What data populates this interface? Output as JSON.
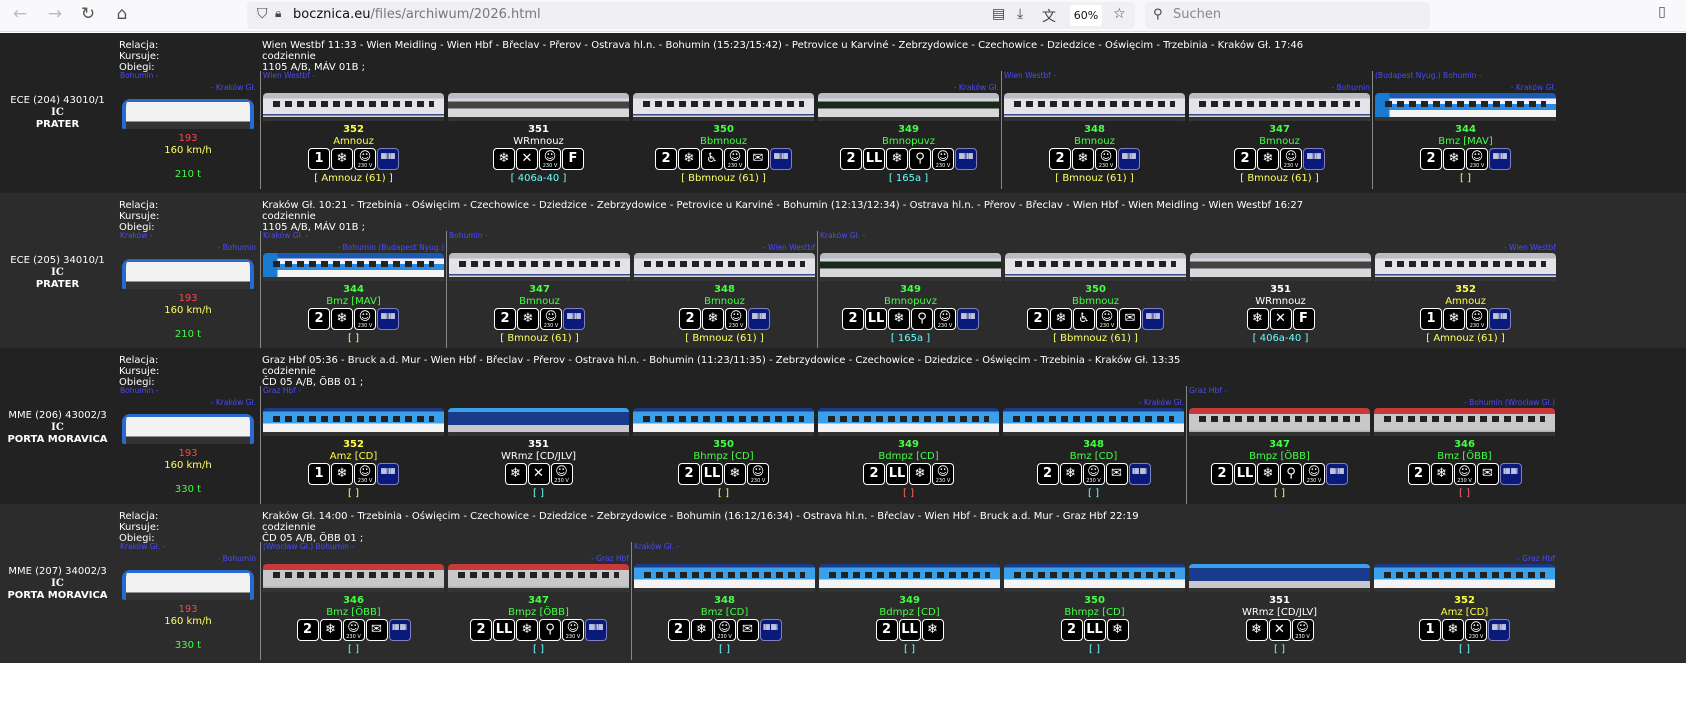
{
  "browser": {
    "url_host": "bocznica.eu",
    "url_path": "/files/archiwum/2026.html",
    "zoom": "60%",
    "search_placeholder": "Suchen"
  },
  "labels": {
    "relacja": "Relacja:",
    "kursuje": "Kursuje:",
    "obiegi": "Obiegi:"
  },
  "colors": {
    "first": "#ffff44",
    "second": "#44ff44",
    "wr": "#ffffff",
    "red": "#ff4444",
    "speed": "#ffff66",
    "weight": "#44ff44",
    "station": "#4a4aff"
  },
  "rows": [
    {
      "category": "ECE (204) 43010/1",
      "carrier": "IC",
      "name": "PRATER",
      "relation": "Wien Westbf 11:33 - Wien Meidling - Wien Hbf - Břeclav - Přerov - Ostrava hl.n. - Bohumin (15:23/15:42) - Petrovice u Karviné - Zebrzydowice - Czechowice - Dziedzice - Oświęcim - Trzebinia - Kraków Gł. 17:46",
      "runs": "codziennie",
      "circuits": "1105 A/B, MÁV 01B ;",
      "loco": {
        "from": "Bohumin -",
        "to": "- Kraków Gł.",
        "number": "193",
        "speed": "160 km/h",
        "weight": "210 t"
      },
      "groups": [
        {
          "from": "Wien Westbf -",
          "to": "- Kraków Gł.",
          "cars": [
            {
              "num": "352",
              "type": "Amnouz",
              "cls": "first",
              "livery": "pkp",
              "icons": [
                "1",
                "snow",
                "socket",
                "seats"
              ],
              "note": "[ Amnouz (61) ]",
              "noteColor": "#ffff66"
            },
            {
              "num": "351",
              "type": "WRmnouz",
              "cls": "wr",
              "livery": "pkpwr",
              "icons": [
                "snow",
                "cutlery",
                "socket",
                "F"
              ],
              "note": "[ 406a-40 ]",
              "noteColor": "#66ffff"
            },
            {
              "num": "350",
              "type": "Bbmnouz",
              "cls": "second",
              "livery": "pkp",
              "icons": [
                "2",
                "snow",
                "wheelchair",
                "socket",
                "envelope",
                "seats"
              ],
              "note": "[ Bbmnouz (61) ]",
              "noteColor": "#ffff66"
            },
            {
              "num": "349",
              "type": "Bmnopuvz",
              "cls": "second",
              "livery": "pkpdark",
              "icons": [
                "2",
                "LL",
                "snow",
                "bike",
                "socket",
                "seats"
              ],
              "note": "[ 165a ]",
              "noteColor": "#66ffff"
            }
          ]
        },
        {
          "from": "Wien Westbf -",
          "to": "- Bohumin",
          "cars": [
            {
              "num": "348",
              "type": "Bmnouz",
              "cls": "second",
              "livery": "pkp",
              "icons": [
                "2",
                "snow",
                "socket",
                "seats"
              ],
              "note": "[ Bmnouz (61) ]",
              "noteColor": "#ffff66"
            },
            {
              "num": "347",
              "type": "Bmnouz",
              "cls": "second",
              "livery": "pkp",
              "icons": [
                "2",
                "snow",
                "socket",
                "seats"
              ],
              "note": "[ Bmnouz (61) ]",
              "noteColor": "#ffff66"
            }
          ]
        },
        {
          "from": "(Budapest Nyug.) Bohumin -",
          "to": "- Kraków Gł.",
          "cars": [
            {
              "num": "344",
              "type": "Bmz [MAV]",
              "cls": "second",
              "livery": "mav",
              "icons": [
                "2",
                "snow",
                "socket",
                "seats"
              ],
              "note": "[ ]",
              "noteColor": "#ffff66"
            }
          ]
        }
      ]
    },
    {
      "category": "ECE (205) 34010/1",
      "carrier": "IC",
      "name": "PRATER",
      "relation": "Kraków Gł. 10:21 - Trzebinia - Oświęcim - Czechowice - Dziedzice - Zebrzydowice - Petrovice u Karviné - Bohumin (12:13/12:34) - Ostrava hl.n. - Přerov - Břeclav - Wien Hbf - Wien Meidling - Wien Westbf 16:27",
      "runs": "codziennie",
      "circuits": "1105 A/B, MÁV 01B ;",
      "loco": {
        "from": "Kraków -",
        "to": "- Bohumin",
        "number": "193",
        "speed": "160 km/h",
        "weight": "210 t"
      },
      "groups": [
        {
          "from": "Kraków Gł. -",
          "to": "- Bohumin (Budapest Nyug.)",
          "cars": [
            {
              "num": "344",
              "type": "Bmz [MAV]",
              "cls": "second",
              "livery": "mav",
              "icons": [
                "2",
                "snow",
                "socket",
                "seats"
              ],
              "note": "[ ]",
              "noteColor": "#ffff66"
            }
          ]
        },
        {
          "from": "Bohumin -",
          "to": "- Wien Westbf",
          "cars": [
            {
              "num": "347",
              "type": "Bmnouz",
              "cls": "second",
              "livery": "pkp",
              "icons": [
                "2",
                "snow",
                "socket",
                "seats"
              ],
              "note": "[ Bmnouz (61) ]",
              "noteColor": "#ffff66"
            },
            {
              "num": "348",
              "type": "Bmnouz",
              "cls": "second",
              "livery": "pkp",
              "icons": [
                "2",
                "snow",
                "socket",
                "seats"
              ],
              "note": "[ Bmnouz (61) ]",
              "noteColor": "#ffff66"
            }
          ]
        },
        {
          "from": "Kraków Gł. -",
          "to": "- Wien Westbf",
          "cars": [
            {
              "num": "349",
              "type": "Bmnopuvz",
              "cls": "second",
              "livery": "pkpdark",
              "icons": [
                "2",
                "LL",
                "snow",
                "bike",
                "socket",
                "seats"
              ],
              "note": "[ 165a ]",
              "noteColor": "#66ffff"
            },
            {
              "num": "350",
              "type": "Bbmnouz",
              "cls": "second",
              "livery": "pkp",
              "icons": [
                "2",
                "snow",
                "wheelchair",
                "socket",
                "envelope",
                "seats"
              ],
              "note": "[ Bbmnouz (61) ]",
              "noteColor": "#ffff66"
            },
            {
              "num": "351",
              "type": "WRmnouz",
              "cls": "wr",
              "livery": "pkpwr",
              "icons": [
                "snow",
                "cutlery",
                "F"
              ],
              "note": "[ 406a-40 ]",
              "noteColor": "#66ffff"
            },
            {
              "num": "352",
              "type": "Amnouz",
              "cls": "first",
              "livery": "pkp",
              "icons": [
                "1",
                "snow",
                "socket",
                "seats"
              ],
              "note": "[ Amnouz (61) ]",
              "noteColor": "#ffff66"
            }
          ]
        }
      ]
    },
    {
      "category": "MME (206) 43002/3",
      "carrier": "IC",
      "name": "PORTA MORAVICA",
      "relation": "Graz Hbf 05:36 - Bruck a.d. Mur - Wien Hbf - Břeclav - Přerov - Ostrava hl.n. - Bohumin (11:23/11:35) - Zebrzydowice - Czechowice - Dziedzice - Oświęcim - Trzebinia - Kraków Gł. 13:35",
      "runs": "codziennie",
      "circuits": "ČD 05 A/B, ÖBB 01 ;",
      "loco": {
        "from": "Bohumin -",
        "to": "- Kraków Gł.",
        "number": "193",
        "speed": "160 km/h",
        "weight": "330 t"
      },
      "groups": [
        {
          "from": "Graz Hbf -",
          "to": "- Kraków Gł.",
          "cars": [
            {
              "num": "352",
              "type": "Amz [CD]",
              "cls": "first",
              "livery": "cd",
              "icons": [
                "1",
                "snow",
                "socket",
                "seats"
              ],
              "note": "[ ]",
              "noteColor": "#ffff66"
            },
            {
              "num": "351",
              "type": "WRmz [CD/JLV]",
              "cls": "wr",
              "livery": "cdwr",
              "icons": [
                "snow",
                "cutlery",
                "socket"
              ],
              "note": "[ ]",
              "noteColor": "#66ffff"
            },
            {
              "num": "350",
              "type": "Bhmpz [CD]",
              "cls": "second",
              "livery": "cd",
              "icons": [
                "2",
                "LL",
                "snow",
                "socket"
              ],
              "note": "[ ]",
              "noteColor": "#ffff66"
            },
            {
              "num": "349",
              "type": "Bdmpz [CD]",
              "cls": "second",
              "livery": "cd",
              "icons": [
                "2",
                "LL",
                "snow",
                "socket"
              ],
              "note": "[ ]",
              "noteColor": "#ff6666"
            },
            {
              "num": "348",
              "type": "Bmz [CD]",
              "cls": "second",
              "livery": "cd",
              "icons": [
                "2",
                "snow",
                "socket",
                "envelope",
                "seats"
              ],
              "note": "[ ]",
              "noteColor": "#66ffff"
            }
          ]
        },
        {
          "from": "Graz Hbf -",
          "to": "- Bohumin (Wrocław Gł.)",
          "cars": [
            {
              "num": "347",
              "type": "Bmpz [ÖBB]",
              "cls": "second",
              "livery": "obb",
              "icons": [
                "2",
                "LL",
                "snow",
                "bike",
                "socket",
                "seats"
              ],
              "note": "[ ]",
              "noteColor": "#ffff66"
            },
            {
              "num": "346",
              "type": "Bmz [ÖBB]",
              "cls": "second",
              "livery": "obb",
              "icons": [
                "2",
                "snow",
                "socket",
                "envelope",
                "seats"
              ],
              "note": "[ ]",
              "noteColor": "#ff6666"
            }
          ]
        }
      ]
    },
    {
      "category": "MME (207) 34002/3",
      "carrier": "IC",
      "name": "PORTA MORAVICA",
      "relation": "Kraków Gł. 14:00 - Trzebinia - Oświęcim - Czechowice - Dziedzice - Zebrzydowice - Bohumin (16:12/16:34) - Ostrava hl.n. - Břeclav - Wien Hbf - Bruck a.d. Mur - Graz Hbf 22:19",
      "runs": "codziennie",
      "circuits": "ČD 05 A/B, ÖBB 01 ;",
      "loco": {
        "from": "Kraków Gł. -",
        "to": "- Bohumin",
        "number": "193",
        "speed": "160 km/h",
        "weight": "330 t"
      },
      "groups": [
        {
          "from": "(Wrocław Gł.) Bohumin -",
          "to": "- Graz Hbf",
          "cars": [
            {
              "num": "346",
              "type": "Bmz [ÖBB]",
              "cls": "second",
              "livery": "obb",
              "icons": [
                "2",
                "snow",
                "socket",
                "envelope",
                "seats"
              ],
              "note": "[ ]",
              "noteColor": "#66ffff"
            },
            {
              "num": "347",
              "type": "Bmpz [ÖBB]",
              "cls": "second",
              "livery": "obb",
              "icons": [
                "2",
                "LL",
                "snow",
                "bike",
                "socket",
                "seats"
              ],
              "note": "[ ]",
              "noteColor": "#66ffff"
            }
          ]
        },
        {
          "from": "Kraków Gł. -",
          "to": "- Graz Hbf",
          "cars": [
            {
              "num": "348",
              "type": "Bmz [CD]",
              "cls": "second",
              "livery": "cd",
              "icons": [
                "2",
                "snow",
                "socket",
                "envelope",
                "seats"
              ],
              "note": "[ ]",
              "noteColor": "#66ffff"
            },
            {
              "num": "349",
              "type": "Bdmpz [CD]",
              "cls": "second",
              "livery": "cd",
              "icons": [
                "2",
                "LL",
                "snow"
              ],
              "note": "[ ]",
              "noteColor": "#66ffff"
            },
            {
              "num": "350",
              "type": "Bhmpz [CD]",
              "cls": "second",
              "livery": "cd",
              "icons": [
                "2",
                "LL",
                "snow"
              ],
              "note": "[ ]",
              "noteColor": "#66ffff"
            },
            {
              "num": "351",
              "type": "WRmz [CD/JLV]",
              "cls": "wr",
              "livery": "cdwr",
              "icons": [
                "snow",
                "cutlery",
                "socket"
              ],
              "note": "[ ]",
              "noteColor": "#66ffff"
            },
            {
              "num": "352",
              "type": "Amz [CD]",
              "cls": "first",
              "livery": "cd",
              "icons": [
                "1",
                "snow",
                "socket",
                "seats"
              ],
              "note": "[ ]",
              "noteColor": "#66ffff"
            }
          ]
        }
      ]
    }
  ]
}
